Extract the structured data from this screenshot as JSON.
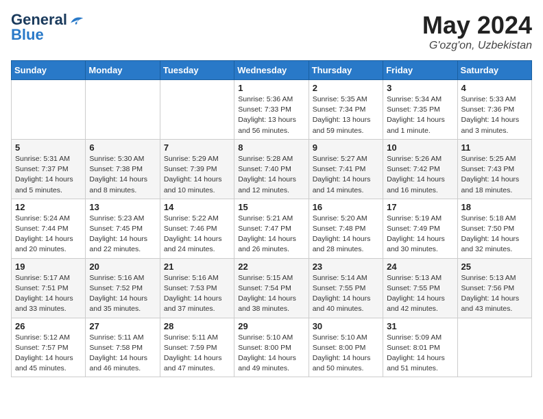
{
  "header": {
    "logo_general": "General",
    "logo_blue": "Blue",
    "month": "May 2024",
    "location": "G'ozg'on, Uzbekistan"
  },
  "weekdays": [
    "Sunday",
    "Monday",
    "Tuesday",
    "Wednesday",
    "Thursday",
    "Friday",
    "Saturday"
  ],
  "weeks": [
    [
      {
        "day": null
      },
      {
        "day": null
      },
      {
        "day": null
      },
      {
        "day": "1",
        "sunrise": "Sunrise: 5:36 AM",
        "sunset": "Sunset: 7:33 PM",
        "daylight": "Daylight: 13 hours and 56 minutes."
      },
      {
        "day": "2",
        "sunrise": "Sunrise: 5:35 AM",
        "sunset": "Sunset: 7:34 PM",
        "daylight": "Daylight: 13 hours and 59 minutes."
      },
      {
        "day": "3",
        "sunrise": "Sunrise: 5:34 AM",
        "sunset": "Sunset: 7:35 PM",
        "daylight": "Daylight: 14 hours and 1 minute."
      },
      {
        "day": "4",
        "sunrise": "Sunrise: 5:33 AM",
        "sunset": "Sunset: 7:36 PM",
        "daylight": "Daylight: 14 hours and 3 minutes."
      }
    ],
    [
      {
        "day": "5",
        "sunrise": "Sunrise: 5:31 AM",
        "sunset": "Sunset: 7:37 PM",
        "daylight": "Daylight: 14 hours and 5 minutes."
      },
      {
        "day": "6",
        "sunrise": "Sunrise: 5:30 AM",
        "sunset": "Sunset: 7:38 PM",
        "daylight": "Daylight: 14 hours and 8 minutes."
      },
      {
        "day": "7",
        "sunrise": "Sunrise: 5:29 AM",
        "sunset": "Sunset: 7:39 PM",
        "daylight": "Daylight: 14 hours and 10 minutes."
      },
      {
        "day": "8",
        "sunrise": "Sunrise: 5:28 AM",
        "sunset": "Sunset: 7:40 PM",
        "daylight": "Daylight: 14 hours and 12 minutes."
      },
      {
        "day": "9",
        "sunrise": "Sunrise: 5:27 AM",
        "sunset": "Sunset: 7:41 PM",
        "daylight": "Daylight: 14 hours and 14 minutes."
      },
      {
        "day": "10",
        "sunrise": "Sunrise: 5:26 AM",
        "sunset": "Sunset: 7:42 PM",
        "daylight": "Daylight: 14 hours and 16 minutes."
      },
      {
        "day": "11",
        "sunrise": "Sunrise: 5:25 AM",
        "sunset": "Sunset: 7:43 PM",
        "daylight": "Daylight: 14 hours and 18 minutes."
      }
    ],
    [
      {
        "day": "12",
        "sunrise": "Sunrise: 5:24 AM",
        "sunset": "Sunset: 7:44 PM",
        "daylight": "Daylight: 14 hours and 20 minutes."
      },
      {
        "day": "13",
        "sunrise": "Sunrise: 5:23 AM",
        "sunset": "Sunset: 7:45 PM",
        "daylight": "Daylight: 14 hours and 22 minutes."
      },
      {
        "day": "14",
        "sunrise": "Sunrise: 5:22 AM",
        "sunset": "Sunset: 7:46 PM",
        "daylight": "Daylight: 14 hours and 24 minutes."
      },
      {
        "day": "15",
        "sunrise": "Sunrise: 5:21 AM",
        "sunset": "Sunset: 7:47 PM",
        "daylight": "Daylight: 14 hours and 26 minutes."
      },
      {
        "day": "16",
        "sunrise": "Sunrise: 5:20 AM",
        "sunset": "Sunset: 7:48 PM",
        "daylight": "Daylight: 14 hours and 28 minutes."
      },
      {
        "day": "17",
        "sunrise": "Sunrise: 5:19 AM",
        "sunset": "Sunset: 7:49 PM",
        "daylight": "Daylight: 14 hours and 30 minutes."
      },
      {
        "day": "18",
        "sunrise": "Sunrise: 5:18 AM",
        "sunset": "Sunset: 7:50 PM",
        "daylight": "Daylight: 14 hours and 32 minutes."
      }
    ],
    [
      {
        "day": "19",
        "sunrise": "Sunrise: 5:17 AM",
        "sunset": "Sunset: 7:51 PM",
        "daylight": "Daylight: 14 hours and 33 minutes."
      },
      {
        "day": "20",
        "sunrise": "Sunrise: 5:16 AM",
        "sunset": "Sunset: 7:52 PM",
        "daylight": "Daylight: 14 hours and 35 minutes."
      },
      {
        "day": "21",
        "sunrise": "Sunrise: 5:16 AM",
        "sunset": "Sunset: 7:53 PM",
        "daylight": "Daylight: 14 hours and 37 minutes."
      },
      {
        "day": "22",
        "sunrise": "Sunrise: 5:15 AM",
        "sunset": "Sunset: 7:54 PM",
        "daylight": "Daylight: 14 hours and 38 minutes."
      },
      {
        "day": "23",
        "sunrise": "Sunrise: 5:14 AM",
        "sunset": "Sunset: 7:55 PM",
        "daylight": "Daylight: 14 hours and 40 minutes."
      },
      {
        "day": "24",
        "sunrise": "Sunrise: 5:13 AM",
        "sunset": "Sunset: 7:55 PM",
        "daylight": "Daylight: 14 hours and 42 minutes."
      },
      {
        "day": "25",
        "sunrise": "Sunrise: 5:13 AM",
        "sunset": "Sunset: 7:56 PM",
        "daylight": "Daylight: 14 hours and 43 minutes."
      }
    ],
    [
      {
        "day": "26",
        "sunrise": "Sunrise: 5:12 AM",
        "sunset": "Sunset: 7:57 PM",
        "daylight": "Daylight: 14 hours and 45 minutes."
      },
      {
        "day": "27",
        "sunrise": "Sunrise: 5:11 AM",
        "sunset": "Sunset: 7:58 PM",
        "daylight": "Daylight: 14 hours and 46 minutes."
      },
      {
        "day": "28",
        "sunrise": "Sunrise: 5:11 AM",
        "sunset": "Sunset: 7:59 PM",
        "daylight": "Daylight: 14 hours and 47 minutes."
      },
      {
        "day": "29",
        "sunrise": "Sunrise: 5:10 AM",
        "sunset": "Sunset: 8:00 PM",
        "daylight": "Daylight: 14 hours and 49 minutes."
      },
      {
        "day": "30",
        "sunrise": "Sunrise: 5:10 AM",
        "sunset": "Sunset: 8:00 PM",
        "daylight": "Daylight: 14 hours and 50 minutes."
      },
      {
        "day": "31",
        "sunrise": "Sunrise: 5:09 AM",
        "sunset": "Sunset: 8:01 PM",
        "daylight": "Daylight: 14 hours and 51 minutes."
      },
      {
        "day": null
      }
    ]
  ]
}
